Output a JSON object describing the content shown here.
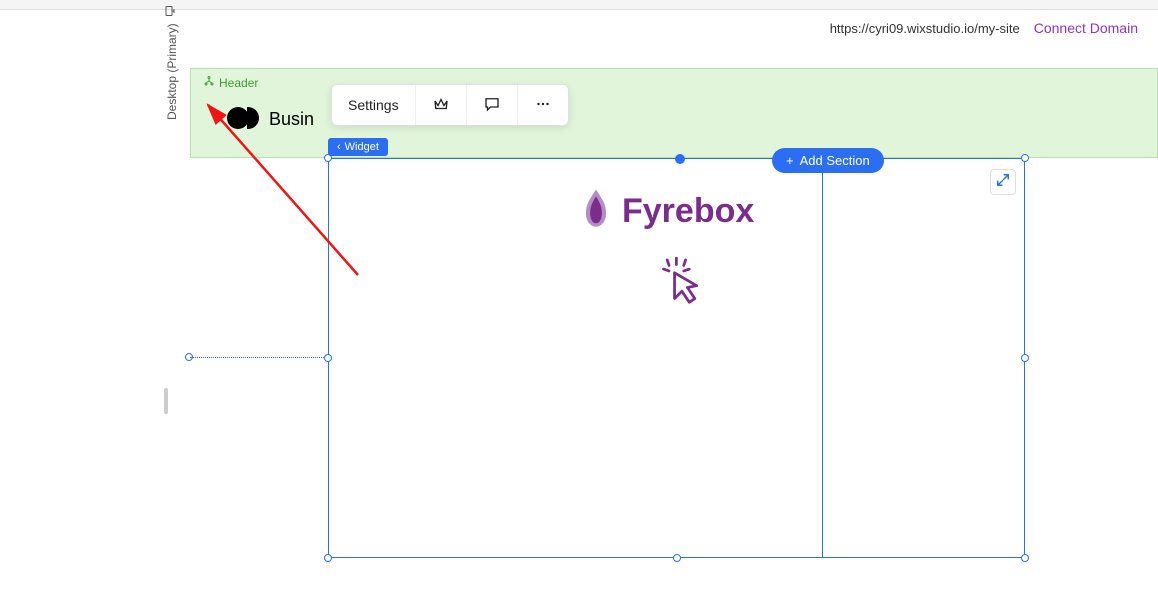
{
  "sidebar": {
    "view_label": "Desktop (Primary)"
  },
  "url_bar": {
    "url": "https://cyri09.wixstudio.io/my-site",
    "connect_label": "Connect Domain"
  },
  "header": {
    "badge_label": "Header",
    "brand_text": "Busin"
  },
  "toolbar": {
    "settings_label": "Settings",
    "upgrade_icon": "crown-icon",
    "comment_icon": "chat-icon",
    "more_icon": "more-icon"
  },
  "selection": {
    "widget_label": "Widget",
    "add_section_label": "Add Section"
  },
  "content": {
    "logo_text": "Fyrebox"
  },
  "colors": {
    "primary": "#2b6ef2",
    "purple": "#7b2d8e",
    "connect": "#9031c7",
    "green": "#3a9f2e"
  }
}
